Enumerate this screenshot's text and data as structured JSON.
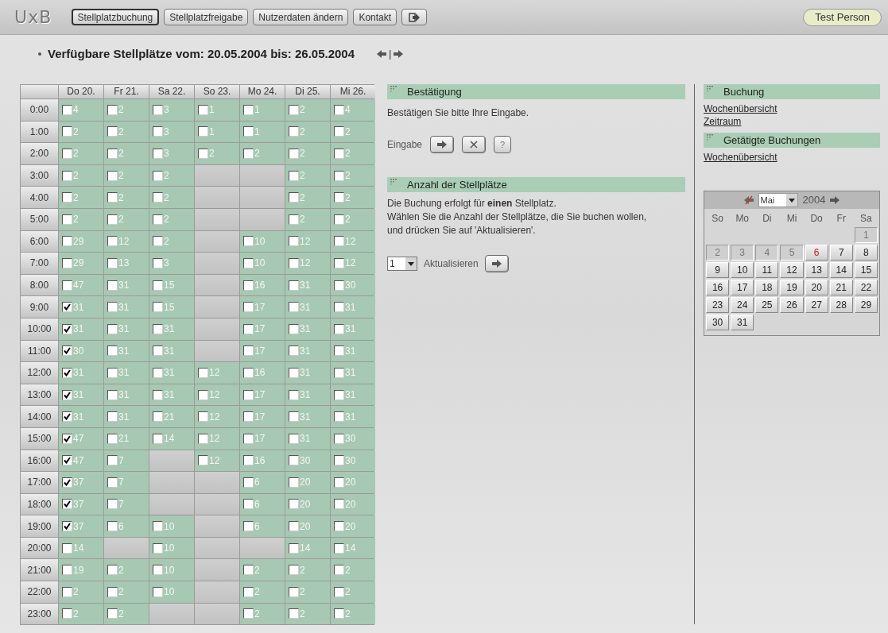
{
  "header": {
    "logo": "UxB",
    "nav": [
      {
        "label": "Stellplatzbuchung",
        "selected": true
      },
      {
        "label": "Stellplatzfreigabe",
        "selected": false
      },
      {
        "label": "Nutzerdaten ändern",
        "selected": false
      },
      {
        "label": "Kontakt",
        "selected": false
      }
    ],
    "user": "Test Person"
  },
  "title": "Verfügbare Stellplätze vom: 20.05.2004 bis: 26.05.2004",
  "title_nav_separator": "|",
  "grid": {
    "columns": [
      "Do 20.",
      "Fr 21.",
      "Sa 22.",
      "So 23.",
      "Mo 24.",
      "Di 25.",
      "Mi 26."
    ],
    "rows": [
      {
        "time": "0:00",
        "cells": [
          {
            "kind": "slot",
            "count": "4",
            "checked": false
          },
          {
            "kind": "slot",
            "count": "2",
            "checked": false
          },
          {
            "kind": "slot",
            "count": "3",
            "checked": false
          },
          {
            "kind": "slot",
            "count": "1",
            "checked": false
          },
          {
            "kind": "slot",
            "count": "1",
            "checked": false
          },
          {
            "kind": "slot",
            "count": "2",
            "checked": false
          },
          {
            "kind": "slot",
            "count": "4",
            "checked": false
          }
        ]
      },
      {
        "time": "1:00",
        "cells": [
          {
            "kind": "slot",
            "count": "2",
            "checked": false
          },
          {
            "kind": "slot",
            "count": "2",
            "checked": false
          },
          {
            "kind": "slot",
            "count": "3",
            "checked": false
          },
          {
            "kind": "slot",
            "count": "1",
            "checked": false
          },
          {
            "kind": "slot",
            "count": "1",
            "checked": false
          },
          {
            "kind": "slot",
            "count": "2",
            "checked": false
          },
          {
            "kind": "slot",
            "count": "2",
            "checked": false
          }
        ]
      },
      {
        "time": "2:00",
        "cells": [
          {
            "kind": "slot",
            "count": "2",
            "checked": false
          },
          {
            "kind": "slot",
            "count": "2",
            "checked": false
          },
          {
            "kind": "slot",
            "count": "3",
            "checked": false
          },
          {
            "kind": "slot",
            "count": "2",
            "checked": false
          },
          {
            "kind": "slot",
            "count": "2",
            "checked": false
          },
          {
            "kind": "slot",
            "count": "2",
            "checked": false
          },
          {
            "kind": "slot",
            "count": "2",
            "checked": false
          }
        ]
      },
      {
        "time": "3:00",
        "cells": [
          {
            "kind": "slot",
            "count": "2",
            "checked": false
          },
          {
            "kind": "slot",
            "count": "2",
            "checked": false
          },
          {
            "kind": "slot",
            "count": "2",
            "checked": false
          },
          {
            "kind": "blocked"
          },
          {
            "kind": "blocked"
          },
          {
            "kind": "slot",
            "count": "2",
            "checked": false
          },
          {
            "kind": "slot",
            "count": "2",
            "checked": false
          }
        ]
      },
      {
        "time": "4:00",
        "cells": [
          {
            "kind": "slot",
            "count": "2",
            "checked": false
          },
          {
            "kind": "slot",
            "count": "2",
            "checked": false
          },
          {
            "kind": "slot",
            "count": "2",
            "checked": false
          },
          {
            "kind": "blocked"
          },
          {
            "kind": "blocked"
          },
          {
            "kind": "slot",
            "count": "2",
            "checked": false
          },
          {
            "kind": "slot",
            "count": "2",
            "checked": false
          }
        ]
      },
      {
        "time": "5:00",
        "cells": [
          {
            "kind": "slot",
            "count": "2",
            "checked": false
          },
          {
            "kind": "slot",
            "count": "2",
            "checked": false
          },
          {
            "kind": "slot",
            "count": "2",
            "checked": false
          },
          {
            "kind": "blocked"
          },
          {
            "kind": "blocked"
          },
          {
            "kind": "slot",
            "count": "2",
            "checked": false
          },
          {
            "kind": "slot",
            "count": "2",
            "checked": false
          }
        ]
      },
      {
        "time": "6:00",
        "cells": [
          {
            "kind": "slot",
            "count": "29",
            "checked": false
          },
          {
            "kind": "slot",
            "count": "12",
            "checked": false
          },
          {
            "kind": "slot",
            "count": "2",
            "checked": false
          },
          {
            "kind": "blocked"
          },
          {
            "kind": "slot",
            "count": "10",
            "checked": false
          },
          {
            "kind": "slot",
            "count": "12",
            "checked": false
          },
          {
            "kind": "slot",
            "count": "12",
            "checked": false
          }
        ]
      },
      {
        "time": "7:00",
        "cells": [
          {
            "kind": "slot",
            "count": "29",
            "checked": false
          },
          {
            "kind": "slot",
            "count": "13",
            "checked": false
          },
          {
            "kind": "slot",
            "count": "3",
            "checked": false
          },
          {
            "kind": "blocked"
          },
          {
            "kind": "slot",
            "count": "10",
            "checked": false
          },
          {
            "kind": "slot",
            "count": "12",
            "checked": false
          },
          {
            "kind": "slot",
            "count": "12",
            "checked": false
          }
        ]
      },
      {
        "time": "8:00",
        "cells": [
          {
            "kind": "slot",
            "count": "47",
            "checked": false
          },
          {
            "kind": "slot",
            "count": "31",
            "checked": false
          },
          {
            "kind": "slot",
            "count": "15",
            "checked": false
          },
          {
            "kind": "blocked"
          },
          {
            "kind": "slot",
            "count": "16",
            "checked": false
          },
          {
            "kind": "slot",
            "count": "31",
            "checked": false
          },
          {
            "kind": "slot",
            "count": "30",
            "checked": false
          }
        ]
      },
      {
        "time": "9:00",
        "cells": [
          {
            "kind": "slot",
            "count": "31",
            "checked": true
          },
          {
            "kind": "slot",
            "count": "31",
            "checked": false
          },
          {
            "kind": "slot",
            "count": "15",
            "checked": false
          },
          {
            "kind": "blocked"
          },
          {
            "kind": "slot",
            "count": "17",
            "checked": false
          },
          {
            "kind": "slot",
            "count": "31",
            "checked": false
          },
          {
            "kind": "slot",
            "count": "31",
            "checked": false
          }
        ]
      },
      {
        "time": "10:00",
        "cells": [
          {
            "kind": "slot",
            "count": "31",
            "checked": true
          },
          {
            "kind": "slot",
            "count": "31",
            "checked": false
          },
          {
            "kind": "slot",
            "count": "31",
            "checked": false
          },
          {
            "kind": "blocked"
          },
          {
            "kind": "slot",
            "count": "17",
            "checked": false
          },
          {
            "kind": "slot",
            "count": "31",
            "checked": false
          },
          {
            "kind": "slot",
            "count": "31",
            "checked": false
          }
        ]
      },
      {
        "time": "11:00",
        "cells": [
          {
            "kind": "slot",
            "count": "30",
            "checked": true
          },
          {
            "kind": "slot",
            "count": "31",
            "checked": false
          },
          {
            "kind": "slot",
            "count": "31",
            "checked": false
          },
          {
            "kind": "blocked"
          },
          {
            "kind": "slot",
            "count": "17",
            "checked": false
          },
          {
            "kind": "slot",
            "count": "31",
            "checked": false
          },
          {
            "kind": "slot",
            "count": "31",
            "checked": false
          }
        ]
      },
      {
        "time": "12:00",
        "cells": [
          {
            "kind": "slot",
            "count": "31",
            "checked": true
          },
          {
            "kind": "slot",
            "count": "31",
            "checked": false
          },
          {
            "kind": "slot",
            "count": "31",
            "checked": false
          },
          {
            "kind": "slot",
            "count": "12",
            "checked": false
          },
          {
            "kind": "slot",
            "count": "16",
            "checked": false
          },
          {
            "kind": "slot",
            "count": "31",
            "checked": false
          },
          {
            "kind": "slot",
            "count": "31",
            "checked": false
          }
        ]
      },
      {
        "time": "13:00",
        "cells": [
          {
            "kind": "slot",
            "count": "31",
            "checked": true
          },
          {
            "kind": "slot",
            "count": "31",
            "checked": false
          },
          {
            "kind": "slot",
            "count": "31",
            "checked": false
          },
          {
            "kind": "slot",
            "count": "12",
            "checked": false
          },
          {
            "kind": "slot",
            "count": "17",
            "checked": false
          },
          {
            "kind": "slot",
            "count": "31",
            "checked": false
          },
          {
            "kind": "slot",
            "count": "31",
            "checked": false
          }
        ]
      },
      {
        "time": "14:00",
        "cells": [
          {
            "kind": "slot",
            "count": "31",
            "checked": true
          },
          {
            "kind": "slot",
            "count": "31",
            "checked": false
          },
          {
            "kind": "slot",
            "count": "21",
            "checked": false
          },
          {
            "kind": "slot",
            "count": "12",
            "checked": false
          },
          {
            "kind": "slot",
            "count": "17",
            "checked": false
          },
          {
            "kind": "slot",
            "count": "31",
            "checked": false
          },
          {
            "kind": "slot",
            "count": "31",
            "checked": false
          }
        ]
      },
      {
        "time": "15:00",
        "cells": [
          {
            "kind": "slot",
            "count": "47",
            "checked": true
          },
          {
            "kind": "slot",
            "count": "21",
            "checked": false
          },
          {
            "kind": "slot",
            "count": "14",
            "checked": false
          },
          {
            "kind": "slot",
            "count": "12",
            "checked": false
          },
          {
            "kind": "slot",
            "count": "17",
            "checked": false
          },
          {
            "kind": "slot",
            "count": "31",
            "checked": false
          },
          {
            "kind": "slot",
            "count": "30",
            "checked": false
          }
        ]
      },
      {
        "time": "16:00",
        "cells": [
          {
            "kind": "slot",
            "count": "47",
            "checked": true
          },
          {
            "kind": "slot",
            "count": "7",
            "checked": false
          },
          {
            "kind": "blocked"
          },
          {
            "kind": "slot",
            "count": "12",
            "checked": false
          },
          {
            "kind": "slot",
            "count": "16",
            "checked": false
          },
          {
            "kind": "slot",
            "count": "30",
            "checked": false
          },
          {
            "kind": "slot",
            "count": "30",
            "checked": false
          }
        ]
      },
      {
        "time": "17:00",
        "cells": [
          {
            "kind": "slot",
            "count": "37",
            "checked": true
          },
          {
            "kind": "slot",
            "count": "7",
            "checked": false
          },
          {
            "kind": "blocked"
          },
          {
            "kind": "blocked"
          },
          {
            "kind": "slot",
            "count": "6",
            "checked": false
          },
          {
            "kind": "slot",
            "count": "20",
            "checked": false
          },
          {
            "kind": "slot",
            "count": "20",
            "checked": false
          }
        ]
      },
      {
        "time": "18:00",
        "cells": [
          {
            "kind": "slot",
            "count": "37",
            "checked": true
          },
          {
            "kind": "slot",
            "count": "7",
            "checked": false
          },
          {
            "kind": "blocked"
          },
          {
            "kind": "blocked"
          },
          {
            "kind": "slot",
            "count": "6",
            "checked": false
          },
          {
            "kind": "slot",
            "count": "20",
            "checked": false
          },
          {
            "kind": "slot",
            "count": "20",
            "checked": false
          }
        ]
      },
      {
        "time": "19:00",
        "cells": [
          {
            "kind": "slot",
            "count": "37",
            "checked": true
          },
          {
            "kind": "slot",
            "count": "6",
            "checked": false
          },
          {
            "kind": "slot",
            "count": "10",
            "checked": false
          },
          {
            "kind": "blocked"
          },
          {
            "kind": "slot",
            "count": "6",
            "checked": false
          },
          {
            "kind": "slot",
            "count": "20",
            "checked": false
          },
          {
            "kind": "slot",
            "count": "20",
            "checked": false
          }
        ]
      },
      {
        "time": "20:00",
        "cells": [
          {
            "kind": "slot",
            "count": "14",
            "checked": false
          },
          {
            "kind": "blocked"
          },
          {
            "kind": "slot",
            "count": "10",
            "checked": false
          },
          {
            "kind": "blocked"
          },
          {
            "kind": "blocked"
          },
          {
            "kind": "slot",
            "count": "14",
            "checked": false
          },
          {
            "kind": "slot",
            "count": "14",
            "checked": false
          }
        ]
      },
      {
        "time": "21:00",
        "cells": [
          {
            "kind": "slot",
            "count": "19",
            "checked": false
          },
          {
            "kind": "slot",
            "count": "2",
            "checked": false
          },
          {
            "kind": "slot",
            "count": "10",
            "checked": false
          },
          {
            "kind": "blocked"
          },
          {
            "kind": "slot",
            "count": "2",
            "checked": false
          },
          {
            "kind": "slot",
            "count": "2",
            "checked": false
          },
          {
            "kind": "slot",
            "count": "2",
            "checked": false
          }
        ]
      },
      {
        "time": "22:00",
        "cells": [
          {
            "kind": "slot",
            "count": "2",
            "checked": false
          },
          {
            "kind": "slot",
            "count": "2",
            "checked": false
          },
          {
            "kind": "slot",
            "count": "10",
            "checked": false
          },
          {
            "kind": "blocked"
          },
          {
            "kind": "slot",
            "count": "2",
            "checked": false
          },
          {
            "kind": "slot",
            "count": "2",
            "checked": false
          },
          {
            "kind": "slot",
            "count": "2",
            "checked": false
          }
        ]
      },
      {
        "time": "23:00",
        "cells": [
          {
            "kind": "slot",
            "count": "2",
            "checked": false
          },
          {
            "kind": "slot",
            "count": "2",
            "checked": false
          },
          {
            "kind": "blocked"
          },
          {
            "kind": "blocked"
          },
          {
            "kind": "slot",
            "count": "2",
            "checked": false
          },
          {
            "kind": "slot",
            "count": "2",
            "checked": false
          },
          {
            "kind": "slot",
            "count": "2",
            "checked": false
          }
        ]
      }
    ]
  },
  "confirmation": {
    "heading": "Bestätigung",
    "text": "Bestätigen Sie bitte Ihre Eingabe.",
    "label": "Eingabe",
    "help": "?"
  },
  "quantity": {
    "heading": "Anzahl der Stellplätze",
    "lines": [
      "Die Buchung erfolgt für **einen** Stellplatz.",
      "Wählen Sie die Anzahl der Stellplätze, die Sie buchen wollen, und drücken Sie auf 'Aktualisieren'."
    ],
    "value": "1",
    "button_label": "Aktualisieren"
  },
  "sidebar": {
    "sections": [
      {
        "heading": "Buchung",
        "links": [
          "Wochenübersicht",
          "Zeitraum"
        ]
      },
      {
        "heading": "Getätigte Buchungen",
        "links": [
          "Wochenübersicht"
        ]
      }
    ]
  },
  "calendar": {
    "month": "Mai",
    "year": "2004",
    "weekdays": [
      "So",
      "Mo",
      "Di",
      "Mi",
      "Do",
      "Fr",
      "Sa"
    ],
    "days": [
      {
        "kind": "blank"
      },
      {
        "kind": "blank"
      },
      {
        "kind": "blank"
      },
      {
        "kind": "blank"
      },
      {
        "kind": "blank"
      },
      {
        "kind": "blank"
      },
      {
        "day": "1",
        "disabled": true,
        "today": false
      },
      {
        "day": "2",
        "disabled": true,
        "today": false
      },
      {
        "day": "3",
        "disabled": true,
        "today": false
      },
      {
        "day": "4",
        "disabled": true,
        "today": false
      },
      {
        "day": "5",
        "disabled": true,
        "today": false
      },
      {
        "day": "6",
        "disabled": false,
        "today": true
      },
      {
        "day": "7",
        "disabled": false,
        "today": false
      },
      {
        "day": "8",
        "disabled": false,
        "today": false
      },
      {
        "day": "9",
        "disabled": false,
        "today": false
      },
      {
        "day": "10",
        "disabled": false,
        "today": false
      },
      {
        "day": "11",
        "disabled": false,
        "today": false
      },
      {
        "day": "12",
        "disabled": false,
        "today": false
      },
      {
        "day": "13",
        "disabled": false,
        "today": false
      },
      {
        "day": "14",
        "disabled": false,
        "today": false
      },
      {
        "day": "15",
        "disabled": false,
        "today": false
      },
      {
        "day": "16",
        "disabled": false,
        "today": false
      },
      {
        "day": "17",
        "disabled": false,
        "today": false
      },
      {
        "day": "18",
        "disabled": false,
        "today": false
      },
      {
        "day": "19",
        "disabled": false,
        "today": false
      },
      {
        "day": "20",
        "disabled": false,
        "today": false
      },
      {
        "day": "21",
        "disabled": false,
        "today": false
      },
      {
        "day": "22",
        "disabled": false,
        "today": false
      },
      {
        "day": "23",
        "disabled": false,
        "today": false
      },
      {
        "day": "24",
        "disabled": false,
        "today": false
      },
      {
        "day": "25",
        "disabled": false,
        "today": false
      },
      {
        "day": "26",
        "disabled": false,
        "today": false
      },
      {
        "day": "27",
        "disabled": false,
        "today": false
      },
      {
        "day": "28",
        "disabled": false,
        "today": false
      },
      {
        "day": "29",
        "disabled": false,
        "today": false
      },
      {
        "day": "30",
        "disabled": false,
        "today": false
      },
      {
        "day": "31",
        "disabled": false,
        "today": false
      }
    ]
  }
}
